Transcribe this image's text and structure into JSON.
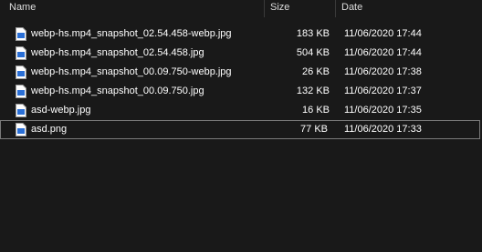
{
  "columns": {
    "name": "Name",
    "size": "Size",
    "date": "Date"
  },
  "files": [
    {
      "name": "webp-hs.mp4_snapshot_02.54.458-webp.jpg",
      "size": "183 KB",
      "date": "11/06/2020 17:44",
      "icon": "jpg-file-icon"
    },
    {
      "name": "webp-hs.mp4_snapshot_02.54.458.jpg",
      "size": "504 KB",
      "date": "11/06/2020 17:44",
      "icon": "jpg-file-icon"
    },
    {
      "name": "webp-hs.mp4_snapshot_00.09.750-webp.jpg",
      "size": "26 KB",
      "date": "11/06/2020 17:38",
      "icon": "jpg-file-icon"
    },
    {
      "name": "webp-hs.mp4_snapshot_00.09.750.jpg",
      "size": "132 KB",
      "date": "11/06/2020 17:37",
      "icon": "jpg-file-icon"
    },
    {
      "name": "asd-webp.jpg",
      "size": "16 KB",
      "date": "11/06/2020 17:35",
      "icon": "jpg-file-icon"
    },
    {
      "name": "asd.png",
      "size": "77 KB",
      "date": "11/06/2020 17:33",
      "icon": "png-file-icon",
      "selected": true
    }
  ],
  "colors": {
    "background": "#191919",
    "text": "#ffffff",
    "header_text": "#dcdcdc",
    "selection_border": "#7a7a7a",
    "icon_blue": "#2a6fd6"
  }
}
